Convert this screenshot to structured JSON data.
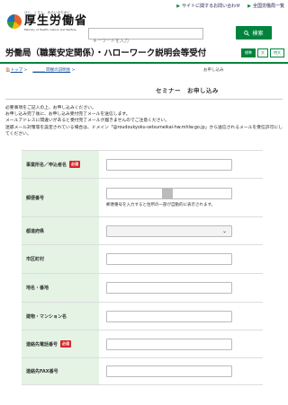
{
  "header": {
    "links": [
      {
        "arrow": "▶",
        "label": "サイトに関するお問い合わせ"
      },
      {
        "arrow": "▶",
        "label": "全国労働局一覧"
      }
    ],
    "logo": {
      "tagline": "ひと、くらし、みらいのために",
      "name": "厚生労働省",
      "en": "Ministry of Health, Labour and Welfare"
    },
    "search": {
      "placeholder": "キーワードを入力",
      "button_label": "検索",
      "icon": "search-icon"
    }
  },
  "page": {
    "title": "労働局（職業安定関係）・ハローワーク説明会等受付",
    "size_labels": [
      "標準",
      "大",
      "特大"
    ],
    "breadcrumb": [
      "トップ",
      "______ 開催の説明会"
    ],
    "sub_small": "お申し込み",
    "sub_title": "セミナー　お申し込み",
    "intro": [
      "必要事項をご記入の上、お申し込みください。",
      "お申し込み完了後に、お申し込み受付完了メールを送信します。",
      "メールアドレスに間違いがあると受付完了メールが届きませんのでご注意ください。",
      "迷惑メール対策等を設定されている場合は、ドメイン「@roudoukyoku-setsumeikai-hw.mhlw.go.jp」から送信されるメールを受信許可にしてください。"
    ]
  },
  "form": {
    "required_label": "必須",
    "postcode_note": "郵便番号を入力すると住所の一部が自動的に表示されます。",
    "rows": [
      {
        "label": "事業所名／申込者名",
        "required": true
      },
      {
        "label": "郵便番号",
        "required": false
      },
      {
        "label": "都道府県",
        "required": false
      },
      {
        "label": "市区町村",
        "required": false
      },
      {
        "label": "地名・番地",
        "required": false
      },
      {
        "label": "建物・マンション名",
        "required": false
      },
      {
        "label": "連絡先電話番号",
        "required": true
      },
      {
        "label": "連絡先FAX番号",
        "required": false
      }
    ]
  },
  "colors": {
    "brand": "#00843d",
    "label_bg": "#e4f3e4",
    "required": "#d8262e"
  }
}
